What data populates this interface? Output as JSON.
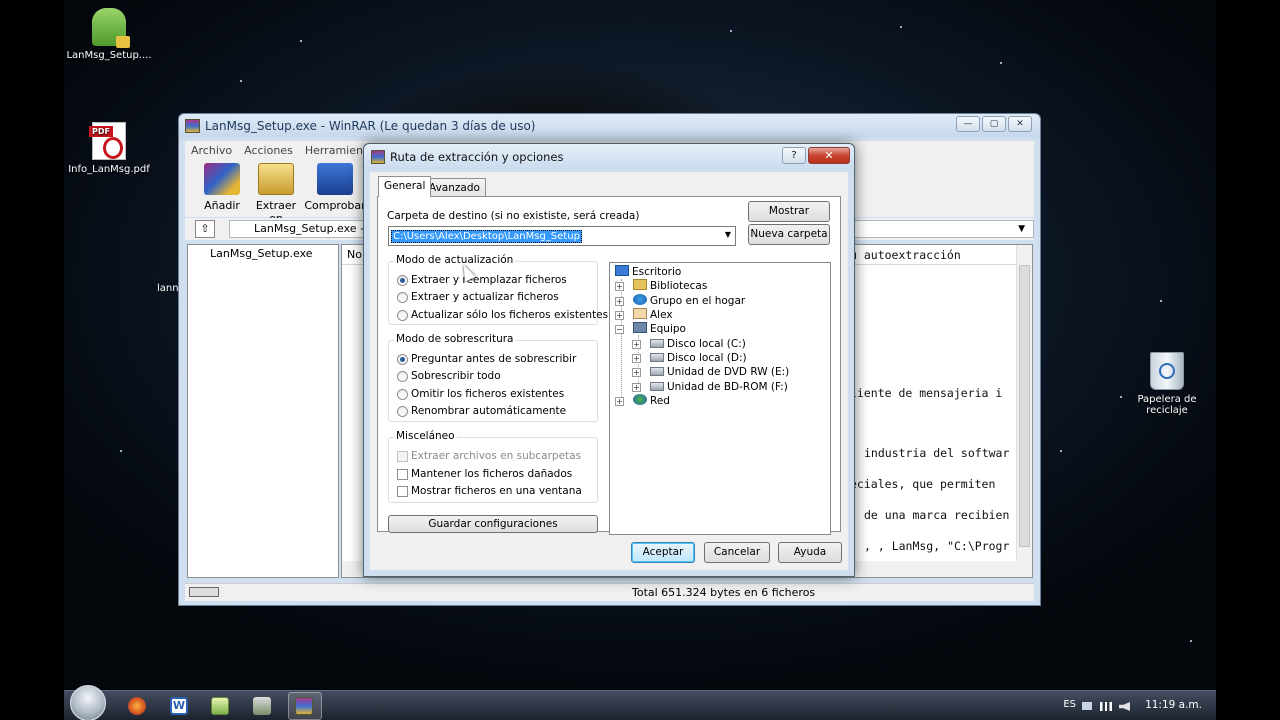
{
  "desktop": {
    "icons": {
      "setup": "LanMsg_Setup....",
      "pdf": "Info_LanMsg.pdf",
      "recycle_bin_line1": "Papelera de",
      "recycle_bin_line2": "reciclaje"
    },
    "partial_label": "lann"
  },
  "winrar": {
    "title": "LanMsg_Setup.exe - WinRAR (Le quedan 3 días de uso)",
    "menu": [
      "Archivo",
      "Acciones",
      "Herramientas"
    ],
    "toolbar": [
      "Añadir",
      "Extraer en",
      "Comprobar"
    ],
    "address": "LanMsg_Setup.exe - Ar",
    "tree_item": "LanMsg_Setup.exe",
    "list_header": "Nor",
    "comment_lines": [
      "u autoextracción",
      "liente de mensajeria i",
      "industria del softwar",
      "eciales, que permiten",
      "de una marca recibien",
      ", , LanMsg, \"C:\\Progr"
    ],
    "status": "Total 651.324 bytes en 6 ficheros"
  },
  "dialog": {
    "title": "Ruta de extracción y opciones",
    "help_label": "?",
    "close_label": "✕",
    "tabs": [
      "General",
      "Avanzado"
    ],
    "dest_label": "Carpeta de destino (si no exististe, será creada)",
    "dest_value": "C:\\Users\\Alex\\Desktop\\LanMsg_Setup",
    "buttons": {
      "show": "Mostrar",
      "new_folder": "Nueva carpeta",
      "save_settings": "Guardar configuraciones",
      "ok": "Aceptar",
      "cancel": "Cancelar",
      "help": "Ayuda"
    },
    "update_mode": {
      "title": "Modo de actualización",
      "options": [
        "Extraer y reemplazar ficheros",
        "Extraer y actualizar ficheros",
        "Actualizar sólo los ficheros existentes"
      ],
      "selected": 0
    },
    "overwrite_mode": {
      "title": "Modo de sobrescritura",
      "options": [
        "Preguntar antes de sobrescribir",
        "Sobrescribir todo",
        "Omitir los ficheros existentes",
        "Renombrar automáticamente"
      ],
      "selected": 0
    },
    "misc": {
      "title": "Misceláneo",
      "options": [
        "Extraer archivos en subcarpetas",
        "Mantener los ficheros dañados",
        "Mostrar ficheros en una ventana"
      ]
    },
    "folder_tree": [
      "Escritorio",
      "Bibliotecas",
      "Grupo en el hogar",
      "Alex",
      "Equipo",
      "Disco local (C:)",
      "Disco local (D:)",
      "Unidad de DVD RW (E:)",
      "Unidad de BD-ROM (F:)",
      "Red"
    ]
  },
  "taskbar": {
    "word_label": "W",
    "language": "ES",
    "clock": "11:19 a.m."
  }
}
